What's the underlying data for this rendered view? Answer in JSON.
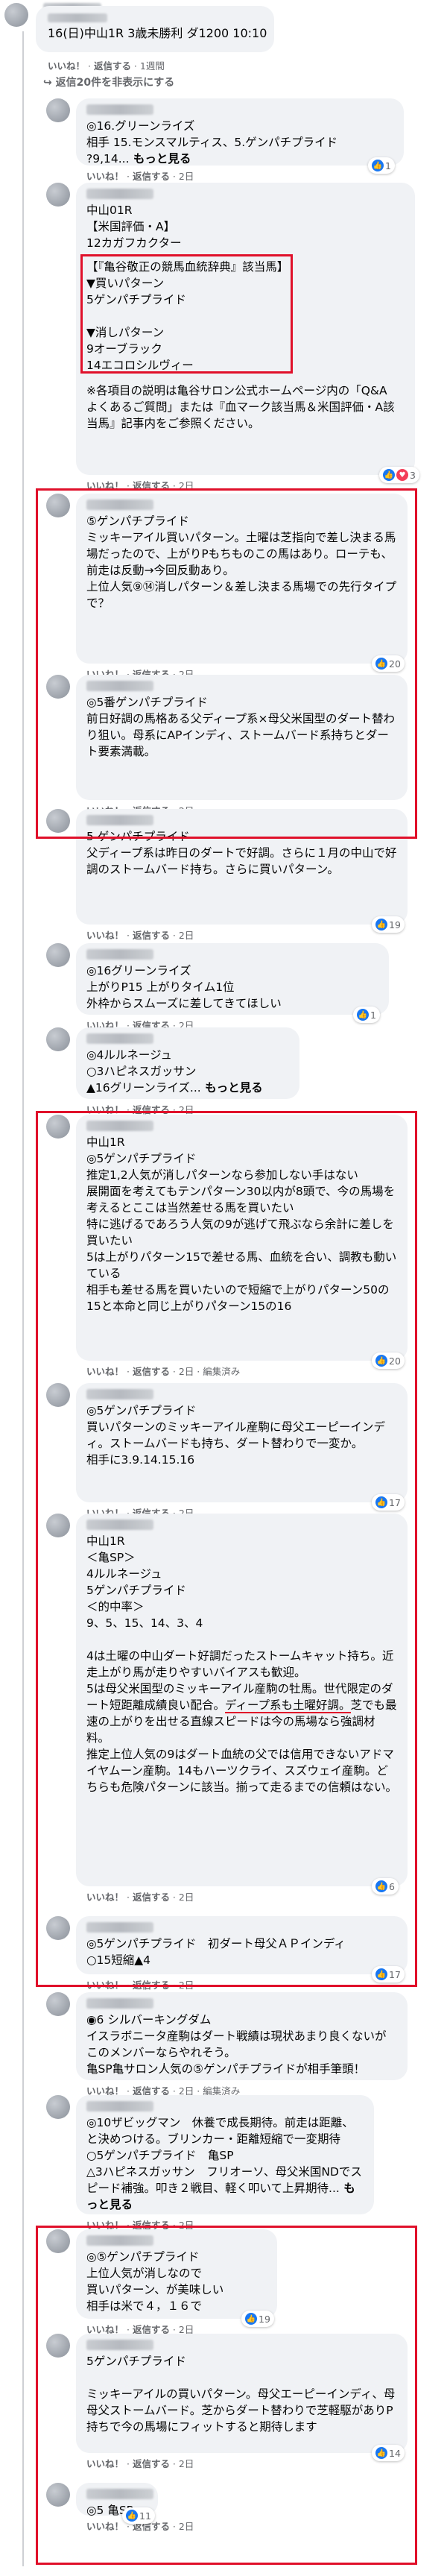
{
  "post": {
    "title": "16(日)中山1R 3歳未勝利 ダ1200 10:10",
    "meta_like": "いいね！",
    "meta_reply": "返信する",
    "meta_time": "1週間",
    "hide_replies": "返信20件を非表示にする"
  },
  "labels": {
    "like": "いいね！",
    "reply": "返信する",
    "edited": "編集済み",
    "more": "もっと見る",
    "time_2d": "2日"
  },
  "comments": [
    {
      "id": "c1",
      "text": "◎16.グリーンライズ\n相手 15.モンスマルティス、5.ゲンパチプライド\n?9,14...",
      "more": true,
      "reacts": "1",
      "react_type": "like"
    },
    {
      "id": "c2",
      "text": "中山01R\n【米国評価・A】\n12カガフカクター",
      "boxed": "【『亀谷敬正の競馬血統辞典』該当馬】\n▼買いパターン\n5ゲンパチプライド\n\n▼消しパターン\n9オーブラック\n14エコロシルヴィー",
      "after": "※各項目の説明は亀谷サロン公式ホームページ内の「Q&A　よくあるご質問」または『血マーク該当馬＆米国評価・A該当馬』記事内をご参照ください。",
      "reacts": "3",
      "react_type": "likeheart"
    },
    {
      "id": "c3",
      "text": "⑤ゲンパチプライド\nミッキーアイル買いパターン。土曜は芝指向で差し決まる馬場だったので、上がりPもちものこの馬はあり。ローテも、前走は反動→今回反動あり。\n上位人気⑨⑭消しパターン＆差し決まる馬場での先行タイプで？",
      "reacts": "20",
      "react_type": "like"
    },
    {
      "id": "c4",
      "text": "◎5番ゲンパチプライド\n前日好調の馬格ある父ディープ系×母父米国型のダート替わり狙い。母系にAPインディ、ストームバード系持ちとダート要素満載。",
      "reacts": "",
      "react_type": "like"
    },
    {
      "id": "c5",
      "text": "5 ゲンパチプライド\n父ディープ系は昨日のダートで好調。さらに１月の中山で好調のストームバード持ち。さらに買いパターン。",
      "reacts": "19",
      "react_type": "like"
    },
    {
      "id": "c6",
      "text": "◎16グリーンライズ\n上がりP15 上がりタイム1位\n外枠からスムーズに差してきてほしい",
      "reacts": "1",
      "react_type": "like"
    },
    {
      "id": "c7",
      "text": "◎4ルルネージュ\n○3ハピネスガッサン\n▲16グリーンライズ...",
      "more": true,
      "reacts": "",
      "react_type": "like"
    },
    {
      "id": "c8",
      "text": "中山1R\n◎5ゲンパチプライド\n推定1,2人気が消しパターンなら参加しない手はない\n展開面を考えてもテンパターン30以内が8頭で、今の馬場を考えるとここは当然差せる馬を買いたい\n特に逃げるであろう人気の9が逃げて飛ぶなら余計に差しを買いたい\n5は上がりパターン15で差せる馬、血統を合い、調教も動いている\n相手も差せる馬を買いたいので短縮で上がりパターン50の15と本命と同じ上がりパターン15の16",
      "reacts": "20",
      "react_type": "like"
    },
    {
      "id": "c9",
      "text": "◎5ゲンパチプライド\n買いパターンのミッキーアイル産駒に母父エーピーインディ。ストームバードも持ち、ダート替わりで一変か。\n相手に3.9.14.15.16",
      "reacts": "17",
      "react_type": "like"
    },
    {
      "id": "c10",
      "text": "中山1R\n＜亀SP＞\n4ルルネージュ\n5ゲンパチプライド\n＜的中率＞\n9、5、15、14、3、4\n\n4は土曜の中山ダート好調だったストームキャット持ち。近走上がり馬が走りやすいバイアスも歓迎。\n5は母父米国型のミッキーアイル産駒の牡馬。世代限定のダート短距離成績良い配合。",
      "underline": "ディープ系も土曜好調。",
      "after": "芝でも最速の上がりを出せる直線スピードは今の馬場なら強調材料。\n推定上位人気の9はダート血統の父では信用できないアドマイヤムーン産駒。14もハーツクライ、スズウェイ産駒。どちらも危険パターンに該当。揃って走るまでの信頼はない。",
      "reacts": "6",
      "react_type": "like"
    },
    {
      "id": "c11",
      "text": "◎5ゲンパチプライド　初ダート母父ＡＰインディ\n○15短縮▲4",
      "reacts": "17",
      "react_type": "like"
    },
    {
      "id": "c12",
      "text": "◉6 シルバーキングダム\nイスラボニータ産駒はダート戦績は現状あまり良くないがこのメンバーならやれそう。\n亀SP亀サロン人気の⑤ゲンパチプライドが相手筆頭！",
      "reacts": "",
      "react_type": "like"
    },
    {
      "id": "c13",
      "text": "◎10ザビッグマン　休養で成長期待。前走は距離、と決めつける。ブリンカー・距離短縮で一変期待\n○5ゲンパチプライド　亀SP\n△3ハピネスガッサン　フリオーソ、母父米国NDでスピード補強。叩き２戦目、軽く叩いて上昇期待...",
      "more": true,
      "reacts": "",
      "react_type": "like"
    },
    {
      "id": "c14",
      "text": "◎⑤ゲンパチプライド\n上位人気が消しなので\n買いパターン、が美味しい\n相手は米で４，１６で",
      "reacts": "19",
      "react_type": "like"
    },
    {
      "id": "c15",
      "text": "5ゲンパチプライド\n\nミッキーアイルの買いパターン。母父エーピーインディ、母母父ストームバード。芝からダート替わりで芝軽駆がありP持ちで今の馬場にフィットすると期待します",
      "reacts": "14",
      "react_type": "like"
    },
    {
      "id": "c16",
      "text": "◎5 亀SP",
      "reacts": "11",
      "react_type": "like"
    }
  ]
}
